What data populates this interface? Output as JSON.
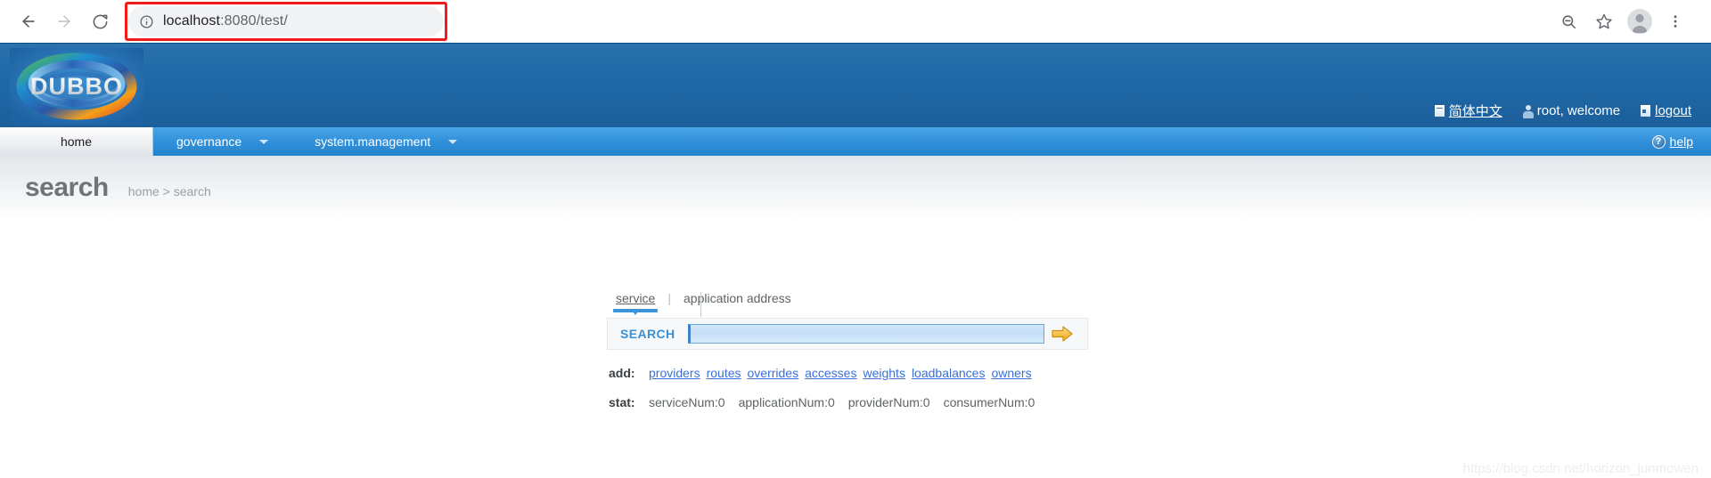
{
  "browser": {
    "back_icon": "back-arrow-icon",
    "forward_icon": "forward-arrow-icon",
    "reload_icon": "reload-icon",
    "info_icon": "info-circle-icon",
    "url_host": "localhost",
    "url_path": ":8080/test/",
    "zoom_out_icon": "zoom-out-icon",
    "bookmark_icon": "star-icon",
    "profile_icon": "avatar-icon",
    "menu_icon": "three-dot-menu-icon",
    "annotation_color": "#f31a1a"
  },
  "header": {
    "logo_text": "DUBBO",
    "links": [
      {
        "name": "language",
        "icon": "document-icon",
        "label": "简体中文",
        "underlined": true
      },
      {
        "name": "user",
        "icon": "person-icon",
        "label": "root, welcome",
        "underlined": false
      },
      {
        "name": "logout",
        "icon": "door-icon",
        "label": "logout",
        "underlined": true
      }
    ],
    "bg_color": "#1e68a6"
  },
  "nav": {
    "tabs": [
      {
        "label": "home",
        "active": true,
        "caret": false
      },
      {
        "label": "governance",
        "active": false,
        "caret": true
      },
      {
        "label": "system.management",
        "active": false,
        "caret": true
      }
    ],
    "help_label": "help",
    "help_icon": "question-circle-icon",
    "bg_color": "#2e8fd8"
  },
  "page": {
    "title": "search",
    "breadcrumb": "home > search"
  },
  "search": {
    "tabs": [
      {
        "label": "service",
        "active": true
      },
      {
        "label": "application address",
        "active": false
      }
    ],
    "separator": "|",
    "button_label": "SEARCH",
    "input_value": "",
    "input_placeholder": "",
    "go_icon": "arrow-right-icon",
    "accent_color": "#3b8fd4"
  },
  "add_row": {
    "key": "add:",
    "links": [
      "providers",
      "routes",
      "overrides",
      "accesses",
      "weights",
      "loadbalances",
      "owners"
    ]
  },
  "stat_row": {
    "key": "stat:",
    "values": [
      "serviceNum:0",
      "applicationNum:0",
      "providerNum:0",
      "consumerNum:0"
    ]
  },
  "watermark": "https://blog.csdn.net/horizon_junmowen"
}
